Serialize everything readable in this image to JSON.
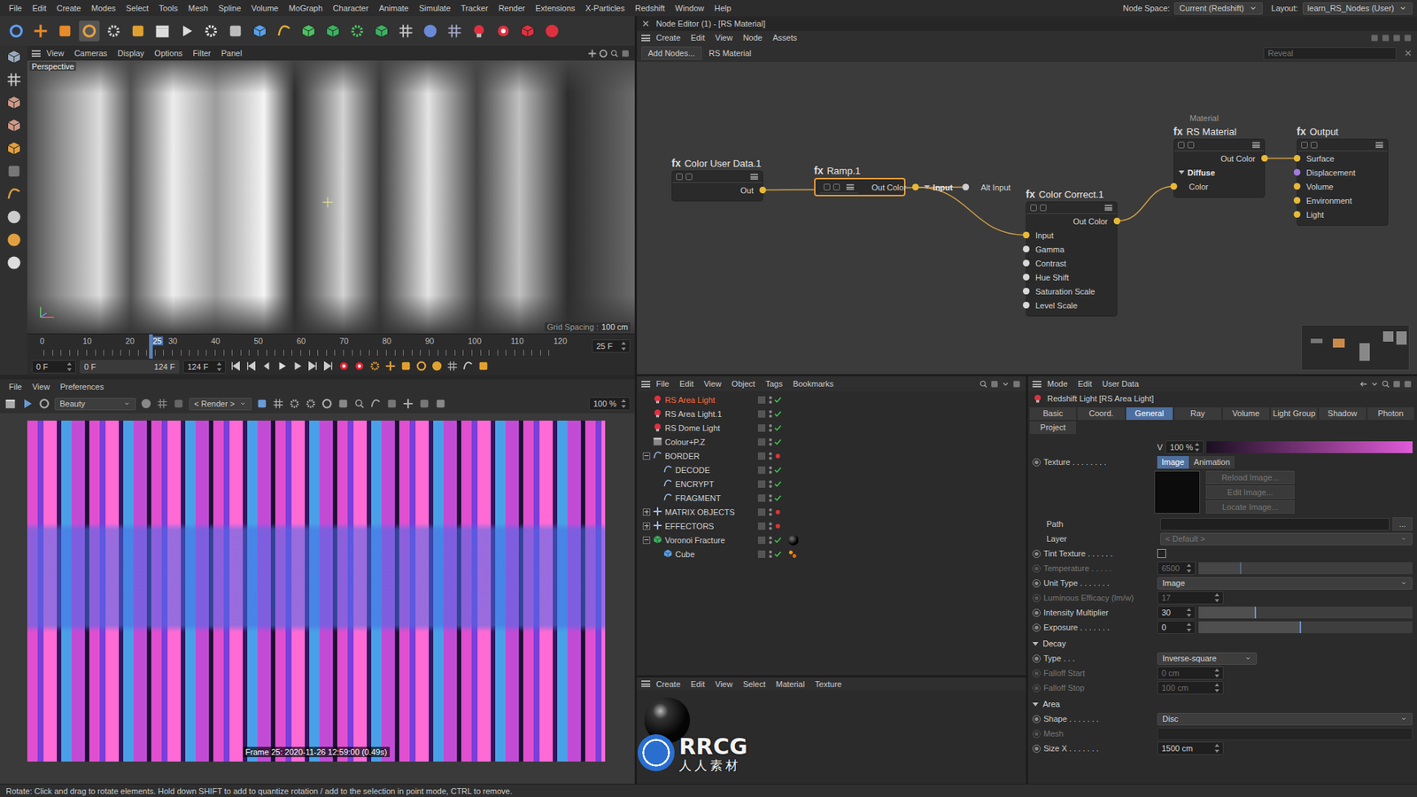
{
  "menu_bar": {
    "items": [
      "File",
      "Edit",
      "Create",
      "Modes",
      "Select",
      "Tools",
      "Mesh",
      "Spline",
      "Volume",
      "MoGraph",
      "Character",
      "Animate",
      "Simulate",
      "Tracker",
      "Render",
      "Extensions",
      "X-Particles",
      "Redshift",
      "Window",
      "Help"
    ],
    "node_space_label": "Node Space:",
    "node_space": "Current (Redshift)",
    "layout_label": "Layout:",
    "layout": "learn_RS_Nodes (User)"
  },
  "viewport": {
    "menu": [
      "View",
      "Cameras",
      "Display",
      "Options",
      "Filter",
      "Panel"
    ],
    "camera": "Perspective",
    "grid_spacing": "Grid Spacing :",
    "grid_value": "100 cm"
  },
  "timeline": {
    "ticks": [
      "0",
      "10",
      "20",
      "25",
      "30",
      "40",
      "50",
      "60",
      "70",
      "80",
      "90",
      "100",
      "110",
      "120"
    ],
    "current": "25",
    "max": 125,
    "frame_field": "25 F"
  },
  "transport": {
    "start": "0 F",
    "range_start": "0 F",
    "range_end": "124 F",
    "end": "124 F"
  },
  "picture_viewer": {
    "menu": [
      "File",
      "View",
      "Preferences"
    ],
    "channel": "Beauty",
    "render_select": "< Render >",
    "zoom": "100 %",
    "frame_info": "Frame 25: 2020-11-26 12:59:00 (0.49s)"
  },
  "node_editor": {
    "title": "Node Editor (1) - [RS Material]",
    "menu": [
      "Create",
      "Edit",
      "View",
      "Node",
      "Assets"
    ],
    "add_nodes": "Add Nodes...",
    "path": "RS Material",
    "search_placeholder": "Reveal",
    "nodes": [
      {
        "icon": "fx",
        "title": "Color User Data.1",
        "selected": false,
        "outputs": [
          "Out"
        ],
        "inputs": []
      },
      {
        "icon": "fx",
        "title": "Ramp.1",
        "selected": true,
        "outputs": [
          "Out Color"
        ],
        "group": "Input",
        "inputs": [
          {
            "name": "Alt Input",
            "color": "#cfcfcf"
          }
        ]
      },
      {
        "icon": "fx",
        "title": "Color Correct.1",
        "selected": false,
        "outputs": [
          "Out Color"
        ],
        "inputs": [
          {
            "name": "Input",
            "color": "#e8b936"
          },
          {
            "name": "Gamma",
            "color": "#d8d8d8"
          },
          {
            "name": "Contrast",
            "color": "#d8d8d8"
          },
          {
            "name": "Hue Shift",
            "color": "#d8d8d8"
          },
          {
            "name": "Saturation Scale",
            "color": "#d8d8d8"
          },
          {
            "name": "Level Scale",
            "color": "#d8d8d8"
          }
        ]
      },
      {
        "icon": "fx",
        "super": "Material",
        "title": "RS Material",
        "selected": false,
        "outputs": [
          "Out Color"
        ],
        "group": "Diffuse",
        "inputs": [
          {
            "name": "Color",
            "color": "#e8b936"
          }
        ]
      },
      {
        "icon": "fx",
        "title": "Output",
        "selected": false,
        "outputs": [],
        "inputs": [
          {
            "name": "Surface",
            "color": "#e8b936"
          },
          {
            "name": "Displacement",
            "color": "#a27be0"
          },
          {
            "name": "Volume",
            "color": "#e8b936"
          },
          {
            "name": "Environment",
            "color": "#e8b936"
          },
          {
            "name": "Light",
            "color": "#e8b936"
          }
        ]
      }
    ],
    "connections": [
      {
        "from": [
          0,
          0
        ],
        "to": [
          1,
          0
        ]
      },
      {
        "from": [
          1,
          0
        ],
        "to": [
          2,
          0
        ]
      },
      {
        "from": [
          2,
          0
        ],
        "to": [
          3,
          0
        ]
      },
      {
        "from": [
          3,
          0
        ],
        "to": [
          4,
          0
        ]
      }
    ]
  },
  "object_manager": {
    "menu": [
      "File",
      "Edit",
      "View",
      "Object",
      "Tags",
      "Bookmarks"
    ],
    "objects": [
      {
        "name": "RS Area Light",
        "kind": "light",
        "depth": 0,
        "expandable": false,
        "expanded": false,
        "selected": true,
        "enabled": true,
        "tags": []
      },
      {
        "name": "RS Area Light.1",
        "kind": "light",
        "depth": 0,
        "expandable": false,
        "expanded": false,
        "selected": false,
        "enabled": true,
        "tags": []
      },
      {
        "name": "RS Dome Light",
        "kind": "light",
        "depth": 0,
        "expandable": false,
        "expanded": false,
        "selected": false,
        "enabled": true,
        "tags": []
      },
      {
        "name": "Colour+P.Z",
        "kind": "layer",
        "depth": 0,
        "expandable": false,
        "expanded": false,
        "selected": false,
        "enabled": true,
        "tags": []
      },
      {
        "name": "BORDER",
        "kind": "spline",
        "depth": 0,
        "expandable": true,
        "expanded": true,
        "selected": false,
        "enabled": false,
        "tags": []
      },
      {
        "name": "DECODE",
        "kind": "spline",
        "depth": 1,
        "expandable": false,
        "expanded": false,
        "selected": false,
        "enabled": true,
        "tags": []
      },
      {
        "name": "ENCRYPT",
        "kind": "spline",
        "depth": 1,
        "expandable": false,
        "expanded": false,
        "selected": false,
        "enabled": true,
        "tags": []
      },
      {
        "name": "FRAGMENT",
        "kind": "spline",
        "depth": 1,
        "expandable": false,
        "expanded": false,
        "selected": false,
        "enabled": true,
        "tags": []
      },
      {
        "name": "MATRIX OBJECTS",
        "kind": "null",
        "depth": 0,
        "expandable": true,
        "expanded": false,
        "selected": false,
        "enabled": false,
        "tags": []
      },
      {
        "name": "EFFECTORS",
        "kind": "null",
        "depth": 0,
        "expandable": true,
        "expanded": false,
        "selected": false,
        "enabled": false,
        "tags": []
      },
      {
        "name": "Voronoi Fracture",
        "kind": "fracture",
        "depth": 0,
        "expandable": true,
        "expanded": true,
        "selected": false,
        "enabled": true,
        "tags": [
          "material"
        ]
      },
      {
        "name": "Cube",
        "kind": "cube",
        "depth": 1,
        "expandable": false,
        "expanded": false,
        "selected": false,
        "enabled": true,
        "tags": [
          "phong"
        ]
      }
    ]
  },
  "material_manager": {
    "menu": [
      "Create",
      "Edit",
      "View",
      "Select",
      "Material",
      "Texture"
    ]
  },
  "watermark": {
    "logo": "RRCG",
    "sub": "人人素材"
  },
  "attributes": {
    "menu": [
      "Mode",
      "Edit",
      "User Data"
    ],
    "title": "Redshift Light [RS Area Light]",
    "tabs": [
      {
        "label": "Basic",
        "selected": false
      },
      {
        "label": "Coord.",
        "selected": false
      },
      {
        "label": "General",
        "selected": true
      },
      {
        "label": "Ray",
        "selected": false
      },
      {
        "label": "Volume",
        "selected": false
      },
      {
        "label": "Light Group",
        "selected": false
      },
      {
        "label": "Shadow",
        "selected": false
      },
      {
        "label": "Photon",
        "selected": false
      },
      {
        "label": "Project",
        "selected": false
      }
    ],
    "color": {
      "label": "V",
      "value": "100 %",
      "level": 1
    },
    "texture": {
      "label": "Texture . . . . . . . .",
      "modes": [
        {
          "label": "Image",
          "selected": true
        },
        {
          "label": "Animation",
          "selected": false
        }
      ],
      "buttons": [
        "Reload Image...",
        "Edit Image...",
        "Locate Image..."
      ],
      "path_label": "Path",
      "path_button": "...",
      "layer_label": "Layer",
      "layer": "< Default >"
    },
    "rows": [
      {
        "kind": "checkbox",
        "label": "Tint Texture . . . . . .",
        "checked": false,
        "disabled": false
      },
      {
        "kind": "slider",
        "label": "Temperature . . . . .",
        "value": "6500",
        "level": 0.2,
        "disabled": true
      },
      {
        "kind": "select",
        "label": "Unit Type . . . . . . .",
        "value": "Image",
        "disabled": false
      },
      {
        "kind": "number",
        "label": "Luminous Efficacy (lm/w)",
        "value": "17",
        "disabled": true
      },
      {
        "kind": "slider",
        "label": "Intensity Multiplier",
        "value": "30",
        "level": 0.27,
        "disabled": false
      },
      {
        "kind": "slider",
        "label": "Exposure . . . . . . .",
        "value": "0",
        "level": 0.48,
        "disabled": false
      }
    ],
    "sections": [
      {
        "title": "Decay",
        "expanded": true,
        "rows": [
          {
            "kind": "select",
            "label": "Type . . .",
            "value": "Inverse-square",
            "disabled": false
          },
          {
            "kind": "number",
            "label": "Falloff Start",
            "value": "0 cm",
            "disabled": true
          },
          {
            "kind": "number",
            "label": "Falloff Stop",
            "value": "100 cm",
            "disabled": true
          }
        ]
      },
      {
        "title": "Area",
        "expanded": true,
        "rows": [
          {
            "kind": "select",
            "label": "Shape . . . . . . .",
            "value": "Disc",
            "disabled": false
          },
          {
            "kind": "link",
            "label": "Mesh",
            "disabled": true
          },
          {
            "kind": "number",
            "label": "Size X . . . . . . .",
            "value": "1500 cm",
            "disabled": false
          }
        ]
      }
    ]
  },
  "status_bar": "Rotate: Click and drag to rotate elements. Hold down SHIFT to add to quantize rotation / add to the selection in point mode, CTRL to remove."
}
